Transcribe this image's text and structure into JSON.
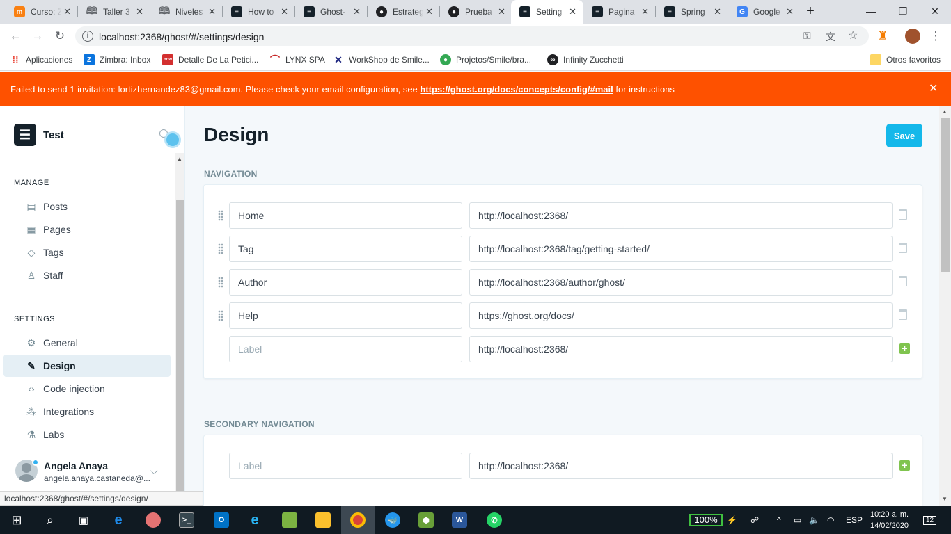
{
  "browser": {
    "tabs": [
      {
        "title": "Curso: Zimbra",
        "icon": "moodle-icon",
        "color": "#f98012"
      },
      {
        "title": "Taller 3",
        "icon": "book-icon",
        "color": "#5f6368"
      },
      {
        "title": "Niveles",
        "icon": "book-icon",
        "color": "#5f6368"
      },
      {
        "title": "How to",
        "icon": "ghost-icon",
        "color": "#15212a"
      },
      {
        "title": "Ghost-",
        "icon": "ghost-icon",
        "color": "#15212a"
      },
      {
        "title": "Estrateg",
        "icon": "github-icon",
        "color": "#202124"
      },
      {
        "title": "Prueba",
        "icon": "github-icon",
        "color": "#202124"
      },
      {
        "title": "Setting",
        "icon": "ghost-icon",
        "color": "#15212a",
        "active": true
      },
      {
        "title": "Pagina",
        "icon": "ghost-icon",
        "color": "#15212a"
      },
      {
        "title": "Spring",
        "icon": "ghost-icon",
        "color": "#15212a"
      },
      {
        "title": "Google",
        "icon": "google-translate-icon",
        "color": "#4285f4"
      }
    ],
    "url": "localhost:2368/ghost/#/settings/design",
    "bookmarks": [
      {
        "label": "Aplicaciones",
        "icon": "apps-grid-icon",
        "color": "#ea4335"
      },
      {
        "label": "Zimbra: Inbox",
        "icon": "zimbra-icon",
        "color": "#0b74de"
      },
      {
        "label": "Detalle De La Petici...",
        "icon": "servicenow-icon",
        "color": "#d32f2f"
      },
      {
        "label": "LYNX SPA",
        "icon": "lynx-icon",
        "color": "#c62828"
      },
      {
        "label": "WorkShop de Smile...",
        "icon": "workshop-icon",
        "color": "#1a237e"
      },
      {
        "label": "Projetos/Smile/bra...",
        "icon": "chrome-icon",
        "color": "#34a853"
      },
      {
        "label": "Infinity Zucchetti",
        "icon": "infinity-icon",
        "color": "#202124"
      }
    ],
    "other_bookmarks": "Otros favoritos",
    "status_url": "localhost:2368/ghost/#/settings/design/"
  },
  "alert": {
    "message": "Failed to send 1 invitation: lortizhernandez83@gmail.com. Please check your email configuration, see ",
    "link": "https://ghost.org/docs/concepts/config/#mail",
    "suffix": " for instructions"
  },
  "sidebar": {
    "blog_name": "Test",
    "manage_heading": "MANAGE",
    "manage_items": [
      {
        "label": "Posts",
        "icon": "posts-icon"
      },
      {
        "label": "Pages",
        "icon": "pages-icon"
      },
      {
        "label": "Tags",
        "icon": "tag-icon"
      },
      {
        "label": "Staff",
        "icon": "staff-icon"
      }
    ],
    "settings_heading": "SETTINGS",
    "settings_items": [
      {
        "label": "General",
        "icon": "gear-icon"
      },
      {
        "label": "Design",
        "icon": "brush-icon",
        "active": true
      },
      {
        "label": "Code injection",
        "icon": "code-icon"
      },
      {
        "label": "Integrations",
        "icon": "integrations-icon"
      },
      {
        "label": "Labs",
        "icon": "flask-icon"
      }
    ],
    "user": {
      "name": "Angela Anaya",
      "email": "angela.anaya.castaneda@..."
    }
  },
  "main": {
    "title": "Design",
    "save_label": "Save",
    "navigation_heading": "NAVIGATION",
    "navigation": [
      {
        "label": "Home",
        "url": "http://localhost:2368/"
      },
      {
        "label": "Tag",
        "url": "http://localhost:2368/tag/getting-started/"
      },
      {
        "label": "Author",
        "url": "http://localhost:2368/author/ghost/"
      },
      {
        "label": "Help",
        "url": "https://ghost.org/docs/"
      }
    ],
    "new_item": {
      "label_placeholder": "Label",
      "url": "http://localhost:2368/"
    },
    "secondary_heading": "SECONDARY NAVIGATION",
    "secondary_new_item": {
      "label_placeholder": "Label",
      "url": "http://localhost:2368/"
    }
  },
  "taskbar": {
    "battery": "100%",
    "language": "ESP",
    "time": "10:20 a. m.",
    "date": "14/02/2020",
    "notifications": "12"
  },
  "colors": {
    "accent": "#14b8ea",
    "alert": "#fe5100",
    "add": "#80c44f"
  }
}
